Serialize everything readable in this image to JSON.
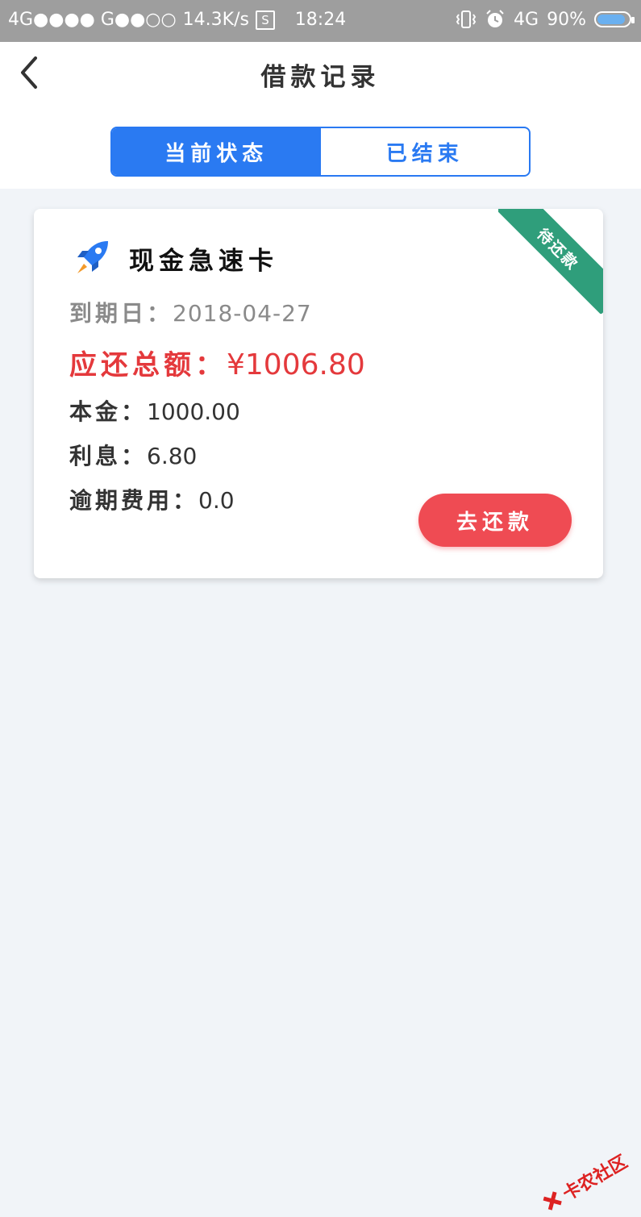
{
  "status_bar": {
    "network_left": "4G●●●● G●●○○",
    "speed": "14.3K/s",
    "s_badge": "S",
    "time": "18:24",
    "network_right": "4G",
    "battery": "90%",
    "battery_level": 0.9,
    "icons": [
      "vibrate-icon",
      "alarm-icon",
      "battery-icon"
    ]
  },
  "header": {
    "title": "借款记录",
    "back_icon": "chevron-left-icon"
  },
  "tabs": [
    {
      "label": "当前状态",
      "active": true
    },
    {
      "label": "已结束",
      "active": false
    }
  ],
  "loan": {
    "icon": "rocket-icon",
    "product_name": "现金急速卡",
    "status_ribbon": "待还款",
    "due_label": "到期日：",
    "due_date": "2018-04-27",
    "total_label": "应还总额：",
    "total_value": "¥1006.80",
    "principal_label": "本金：",
    "principal_value": "1000.00",
    "interest_label": "利息：",
    "interest_value": "6.80",
    "overdue_label": "逾期费用：",
    "overdue_value": "0.0",
    "repay_button": "去还款"
  },
  "colors": {
    "primary": "#2a7af2",
    "danger": "#ef4b53",
    "ribbon": "#2f9e7b",
    "background": "#f1f4f8"
  },
  "watermark": {
    "text": "卡农社区"
  }
}
